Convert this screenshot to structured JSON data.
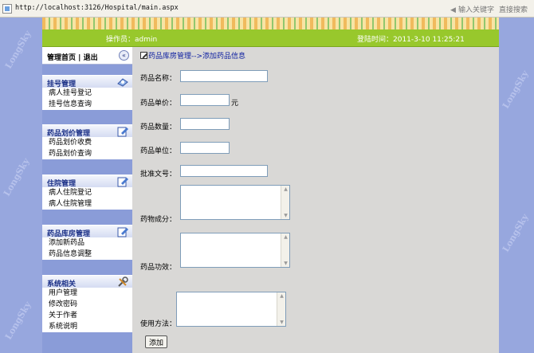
{
  "browser": {
    "address": "http://localhost:3126/Hospital/main.aspx",
    "search_placeholder": "输入关键字",
    "search_action": "直接搜索"
  },
  "watermark": "LongSky",
  "header": {
    "operator_label": "操作员：admin",
    "login_time": "登陆时间：2011-3-10 11:25:21"
  },
  "sidebar": {
    "home": "管理首页",
    "divider": "|",
    "logout": "退出",
    "collapse_glyph": "«",
    "groups": [
      {
        "title": "挂号管理",
        "items": [
          "病人挂号登记",
          "挂号信息查询"
        ]
      },
      {
        "title": "药品划价管理",
        "items": [
          "药品划价收费",
          "药品划价查询"
        ]
      },
      {
        "title": "住院管理",
        "items": [
          "病人住院登记",
          "病人住院管理"
        ]
      },
      {
        "title": "药品库房管理",
        "items": [
          "添加新药品",
          "药品信息调整"
        ]
      },
      {
        "title": "系统相关",
        "items": [
          "用户管理",
          "修改密码",
          "关于作者",
          "系统说明"
        ]
      }
    ]
  },
  "content": {
    "breadcrumb": "药品库房管理-->添加药品信息",
    "fields": {
      "name": "药品名称：",
      "price": "药品单价：",
      "price_unit": "元",
      "quantity": "药品数量：",
      "unit": "药品单位：",
      "approval": "批准文号：",
      "ingredients": "药物成分：",
      "efficacy": "药品功效：",
      "usage": "使用方法："
    },
    "submit": "添加"
  }
}
